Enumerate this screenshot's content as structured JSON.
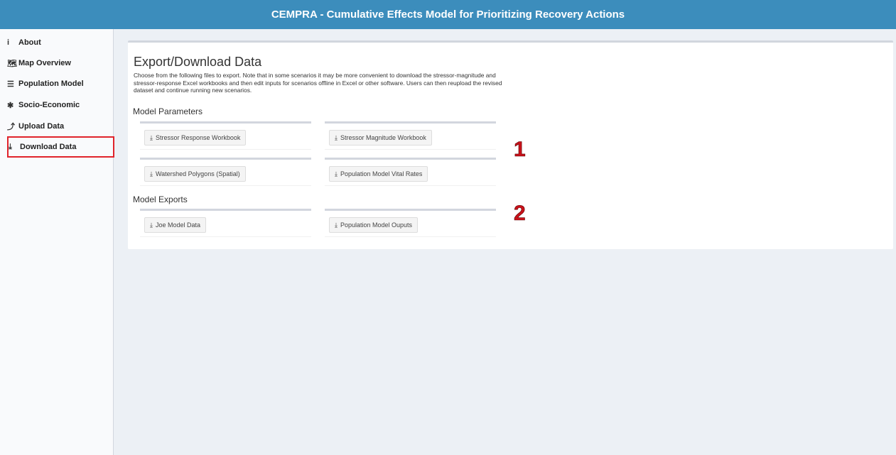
{
  "header": {
    "title": "CEMPRA - Cumulative Effects Model for Prioritizing Recovery Actions"
  },
  "sidebar": {
    "items": [
      {
        "icon": "info-icon",
        "glyph": "i",
        "label": "About"
      },
      {
        "icon": "map-icon",
        "glyph": "🗺",
        "label": "Map Overview"
      },
      {
        "icon": "list-icon",
        "glyph": "☰",
        "label": "Population Model"
      },
      {
        "icon": "asterisk-icon",
        "glyph": "✱",
        "label": "Socio-Economic"
      },
      {
        "icon": "upload-icon",
        "glyph": "⤴",
        "label": "Upload Data"
      },
      {
        "icon": "download-icon",
        "glyph": "⤓",
        "label": "Download Data"
      }
    ],
    "active": "Download Data"
  },
  "main": {
    "title": "Export/Download Data",
    "description": "Choose from the following files to export. Note that in some scenarios it may be more convenient to download the stressor-magnitude and stressor-response Excel workbooks and then edit inputs for scenarios offline in Excel or other software. Users can then reupload the revised dataset and continue running new scenarios.",
    "model_parameters": {
      "title": "Model Parameters",
      "buttons": [
        "Stressor Response Workbook",
        "Stressor Magnitude Workbook",
        "Watershed Polygons (Spatial)",
        "Population Model Vital Rates"
      ]
    },
    "model_exports": {
      "title": "Model Exports",
      "buttons": [
        "Joe Model Data",
        "Population Model Ouputs"
      ]
    }
  },
  "annotations": {
    "marker1": "1",
    "marker2": "2"
  },
  "colors": {
    "header": "#3c8dbc",
    "highlight": "#e0232b",
    "marker": "#c9111a"
  }
}
